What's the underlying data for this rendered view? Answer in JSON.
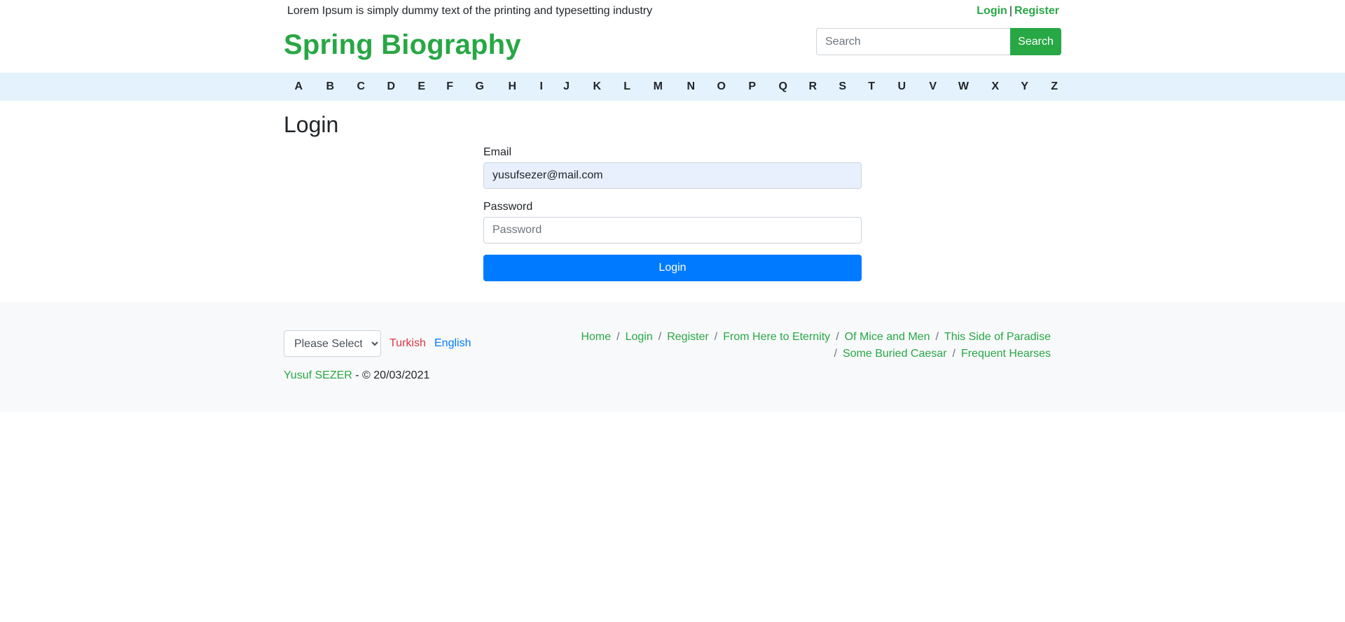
{
  "topbar": {
    "tagline": "Lorem Ipsum is simply dummy text of the printing and typesetting industry",
    "login_label": "Login",
    "separator": "|",
    "register_label": "Register"
  },
  "header": {
    "brand": "Spring Biography",
    "search_placeholder": "Search",
    "search_button": "Search"
  },
  "alphabet": [
    "A",
    "B",
    "C",
    "D",
    "E",
    "F",
    "G",
    "H",
    "I",
    "J",
    "K",
    "L",
    "M",
    "N",
    "O",
    "P",
    "Q",
    "R",
    "S",
    "T",
    "U",
    "V",
    "W",
    "X",
    "Y",
    "Z"
  ],
  "main": {
    "title": "Login",
    "email_label": "Email",
    "email_value": "yusufsezer@mail.com",
    "password_label": "Password",
    "password_placeholder": "Password",
    "login_button": "Login"
  },
  "footer": {
    "select_value": "Please Select",
    "lang_turkish": "Turkish",
    "lang_english": "English",
    "author": "Yusuf SEZER",
    "copyright_text": " - © 20/03/2021",
    "breadcrumbs": [
      "Home",
      "Login",
      "Register",
      "From Here to Eternity",
      "Of Mice and Men",
      "This Side of Paradise",
      "Some Buried Caesar",
      "Frequent Hearses"
    ],
    "crumb_separator": "/"
  },
  "colors": {
    "brand_green": "#28a745",
    "primary_blue": "#007bff",
    "danger_red": "#dc3545",
    "alphabar_bg": "#e3f2fd",
    "footer_bg": "#f8f9fa",
    "autofill_bg": "#e8f0fe"
  }
}
